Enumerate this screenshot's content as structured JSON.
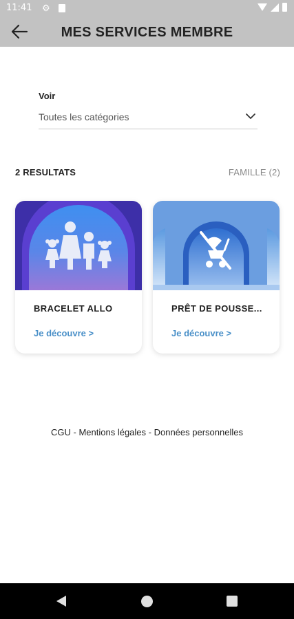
{
  "status_bar": {
    "time": "11:41"
  },
  "app_bar": {
    "title": "MES SERVICES MEMBRE",
    "back_icon": "arrow-left-icon"
  },
  "filter": {
    "label": "Voir",
    "selected": "Toutes les catégories",
    "icon": "chevron-down-icon"
  },
  "results": {
    "count_label": "2 RESULTATS",
    "filter_label": "FAMILLE (2)"
  },
  "cards": [
    {
      "title": "BRACELET ALLO",
      "link": "Je découvre >",
      "icon": "family-icon"
    },
    {
      "title": "PRÊT DE POUSSE...",
      "link": "Je découvre >",
      "icon": "stroller-icon"
    }
  ],
  "footer": {
    "cgu": "CGU",
    "sep1": " - ",
    "mentions": "Mentions légales",
    "sep2": " - ",
    "donnees": "Données personnelles"
  },
  "colors": {
    "app_bar": "#c2c2c2",
    "link": "#4a90c8",
    "card1_bg": "#6a52c8",
    "card2_bg": "#3f74c0"
  }
}
